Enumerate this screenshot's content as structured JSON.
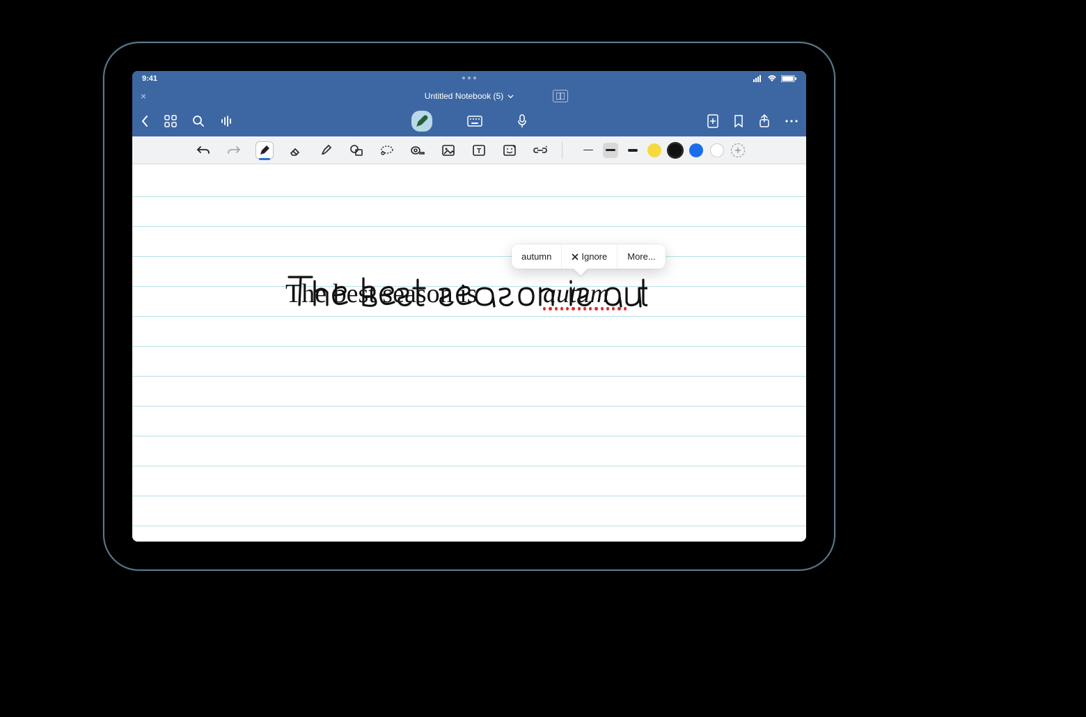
{
  "status": {
    "time": "9:41"
  },
  "title": {
    "notebook_name": "Untitled Notebook (5)"
  },
  "handwriting": {
    "text_full": "The best season is autum",
    "misspelled_word": "autum"
  },
  "spellcheck_popover": {
    "suggestion": "autumn",
    "ignore_label": "Ignore",
    "more_label": "More..."
  },
  "tool_icons": {
    "undo": "undo",
    "redo": "redo",
    "pen": "pen",
    "eraser": "eraser",
    "highlighter": "highlighter",
    "shapes": "shapes",
    "lasso": "lasso",
    "tape": "tape",
    "image": "image",
    "text": "text",
    "sticker": "sticker",
    "link": "link"
  },
  "stroke_widths": {
    "thin": 1,
    "medium": 2,
    "thick": 4
  },
  "colors": {
    "yellow": "#f7d93e",
    "black": "#111111",
    "blue": "#1a6fe8",
    "white": "#ffffff"
  }
}
